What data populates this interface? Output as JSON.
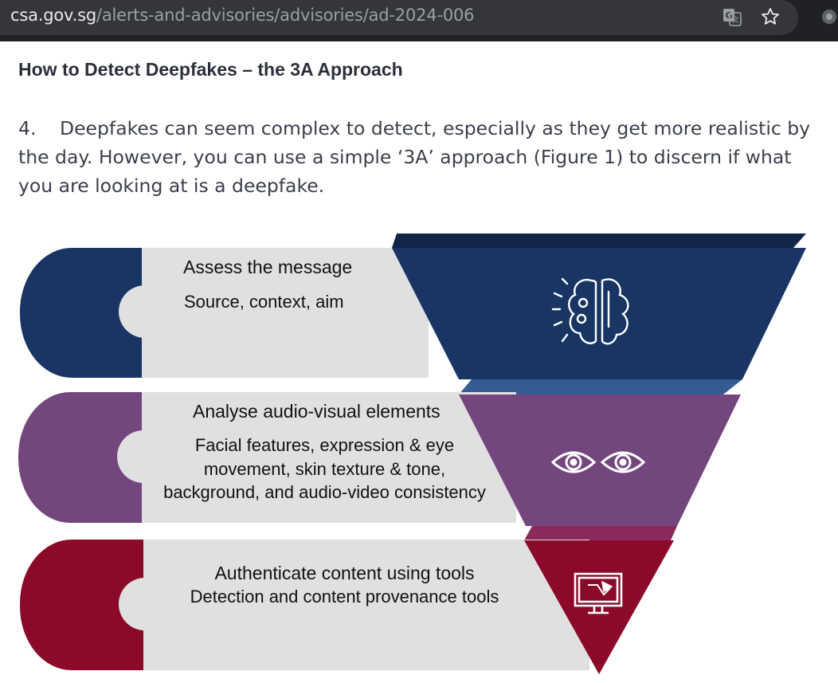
{
  "browser": {
    "url_domain": "csa.gov.sg",
    "url_path": "/alerts-and-advisories/advisories/ad-2024-006",
    "icons": [
      "translate-icon",
      "bookmark-star-icon",
      "extension-icon"
    ]
  },
  "article": {
    "heading": "How to Detect Deepfakes – the 3A Approach",
    "paragraph_number": "4.",
    "paragraph_text": "Deepfakes can seem complex to detect, especially as they get more realistic by the day. However, you can use a simple ‘3A’ approach (Figure 1) to discern if what you are looking at is a deepfake."
  },
  "figure": {
    "steps": [
      {
        "title": "Assess the message",
        "desc": [
          "Source, context, aim"
        ],
        "icon": "brain-gears-icon",
        "color": "#183564"
      },
      {
        "title": "Analyse audio-visual elements",
        "desc": [
          "Facial features, expression & eye",
          "movement, skin texture & tone,",
          "background, and audio-video consistency"
        ],
        "icon": "eyes-icon",
        "color": "#74467e"
      },
      {
        "title": "Authenticate content using tools",
        "desc": [
          "Detection and content provenance tools"
        ],
        "icon": "monitor-tool-icon",
        "color": "#8c0a29"
      }
    ]
  },
  "colors": {
    "navy": "#183564",
    "purple": "#74467e",
    "crimson": "#8c0a29",
    "light_panel": "#e0e0e0",
    "url_bar": "#35363a"
  }
}
